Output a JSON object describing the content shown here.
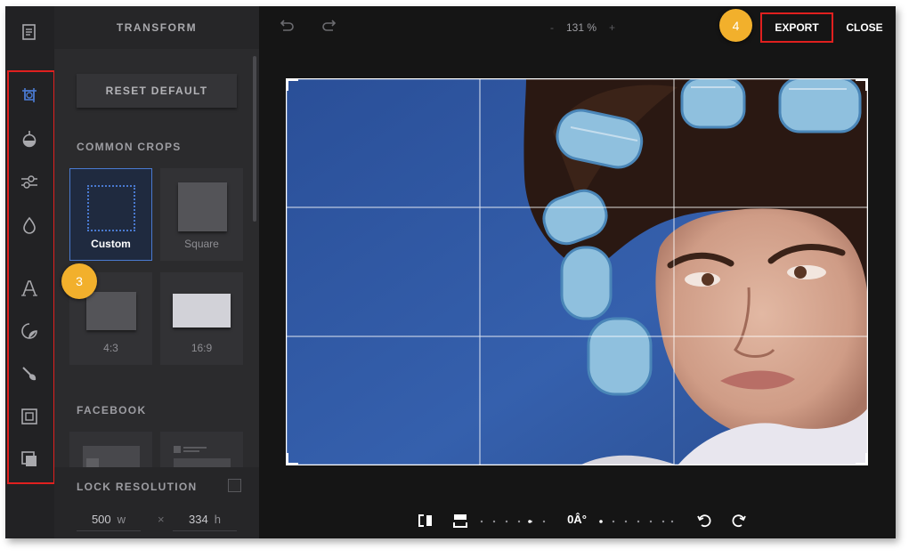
{
  "panel": {
    "title": "TRANSFORM",
    "reset_label": "RESET DEFAULT",
    "common_crops_title": "COMMON CROPS",
    "crops": [
      {
        "label": "Custom"
      },
      {
        "label": "Square"
      },
      {
        "label": "4:3"
      },
      {
        "label": "16:9"
      }
    ],
    "facebook_title": "FACEBOOK",
    "lock_label": "LOCK RESOLUTION",
    "width_value": "500",
    "width_unit": "w",
    "times": "×",
    "height_value": "334",
    "height_unit": "h"
  },
  "toolbar": {
    "items": [
      {
        "icon": "layers-icon"
      },
      {
        "icon": "crop-icon"
      },
      {
        "icon": "filter-icon"
      },
      {
        "icon": "adjust-sliders-icon"
      },
      {
        "icon": "drop-icon"
      },
      {
        "icon": "text-icon"
      },
      {
        "icon": "sticker-icon"
      },
      {
        "icon": "brush-icon"
      },
      {
        "icon": "frame-icon"
      },
      {
        "icon": "overlay-icon"
      }
    ]
  },
  "header": {
    "zoom_minus": "-",
    "zoom_value": "131 %",
    "zoom_plus": "+",
    "export_label": "EXPORT",
    "close_label": "CLOSE"
  },
  "annotations": {
    "badge_3": "3",
    "badge_4": "4"
  },
  "rotation": {
    "angle_label": "0Â°"
  },
  "colors": {
    "accent": "#4a7ad0",
    "highlight": "#e0201f",
    "badge": "#f2b02c",
    "photo_background": "#2f56a0"
  }
}
